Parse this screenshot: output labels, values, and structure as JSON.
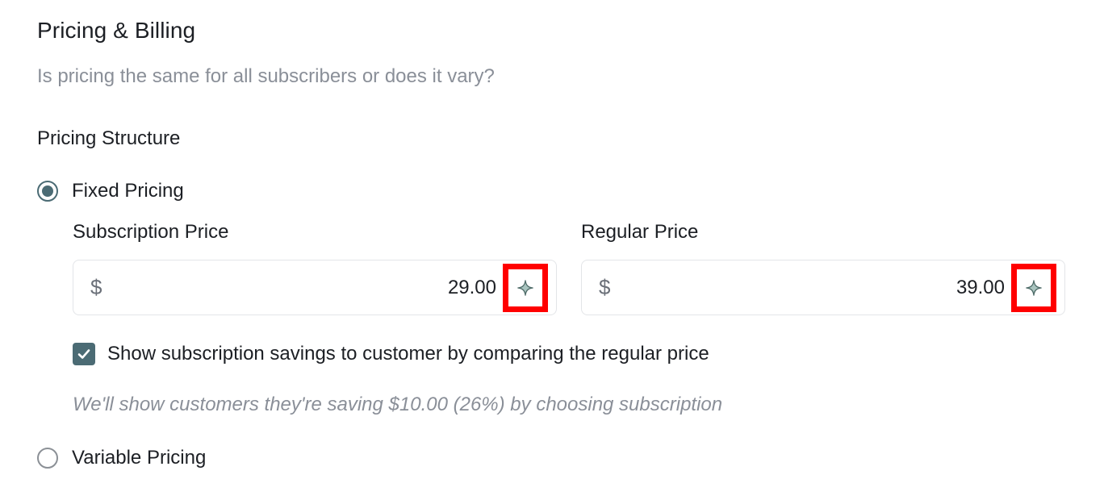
{
  "section": {
    "title": "Pricing & Billing",
    "subtitle": "Is pricing the same for all subscribers or does it vary?",
    "structure_label": "Pricing Structure"
  },
  "pricing_options": {
    "fixed": {
      "label": "Fixed Pricing",
      "selected": true
    },
    "variable": {
      "label": "Variable Pricing",
      "selected": false
    }
  },
  "subscription_price": {
    "label": "Subscription Price",
    "currency": "$",
    "value": "29.00",
    "action_icon": "sparkle-icon"
  },
  "regular_price": {
    "label": "Regular Price",
    "currency": "$",
    "value": "39.00",
    "action_icon": "sparkle-icon"
  },
  "show_savings": {
    "label": "Show subscription savings to customer by comparing the regular price",
    "checked": true
  },
  "savings_note": "We'll show customers they're saving $10.00 (26%) by choosing subscription",
  "colors": {
    "accent": "#4b6b74",
    "highlight": "#ff0000",
    "muted_text": "#8a8f98"
  }
}
